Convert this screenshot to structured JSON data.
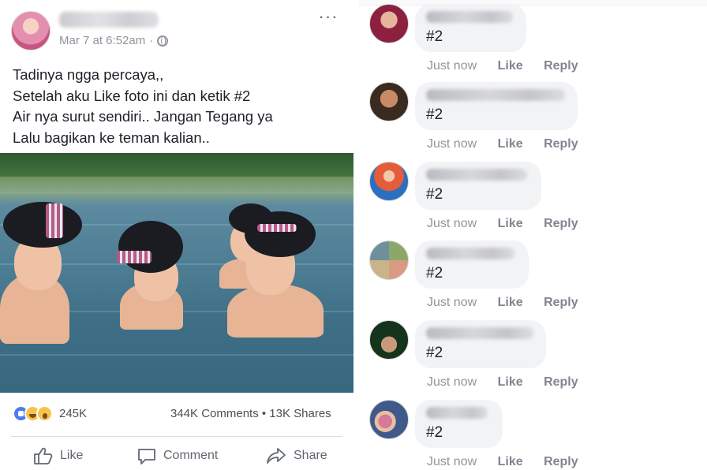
{
  "post": {
    "author_name": "",
    "timestamp": "Mar 7 at 6:52am",
    "separator": "·",
    "privacy_icon": "globe-icon",
    "more_icon": "more-horizontal-icon",
    "more_label": "···",
    "text_lines": [
      "Tadinya ngga percaya,,",
      "Setelah aku Like foto ini dan ketik #2",
      "Air nya surut sendiri.. Jangan Tegang ya",
      "Lalu bagikan ke teman kalian.."
    ],
    "reactions": {
      "icons": [
        "like-reaction-icon",
        "haha-reaction-icon",
        "wow-reaction-icon"
      ],
      "count": "245K"
    },
    "engagement": "344K Comments • 13K Shares",
    "actions": {
      "like": "Like",
      "comment": "Comment",
      "share": "Share"
    }
  },
  "comments": [
    {
      "author_name": "",
      "text": "#2",
      "time": "Just now",
      "like": "Like",
      "reply": "Reply",
      "avatar_colors": [
        "#8b2040",
        "#e7b49c"
      ]
    },
    {
      "author_name": "",
      "text": "#2",
      "time": "Just now",
      "like": "Like",
      "reply": "Reply",
      "avatar_colors": [
        "#3a2a20",
        "#c98b63"
      ]
    },
    {
      "author_name": "",
      "text": "#2",
      "time": "Just now",
      "like": "Like",
      "reply": "Reply",
      "avatar_colors": [
        "#2a6fc2",
        "#e45c3a"
      ]
    },
    {
      "author_name": "",
      "text": "#2",
      "time": "Just now",
      "like": "Like",
      "reply": "Reply",
      "avatar_colors": [
        "#8aa86a",
        "#d99a84"
      ]
    },
    {
      "author_name": "",
      "text": "#2",
      "time": "Just now",
      "like": "Like",
      "reply": "Reply",
      "avatar_colors": [
        "#14341c",
        "#c99a7a"
      ]
    },
    {
      "author_name": "",
      "text": "#2",
      "time": "Just now",
      "like": "Like",
      "reply": "Reply",
      "avatar_colors": [
        "#3f5a8a",
        "#d47a9a"
      ]
    }
  ],
  "colors": {
    "link_gray": "#90949c",
    "action_gray": "#606770",
    "bubble": "#f2f3f5",
    "like_blue": "#4b7bf4",
    "reaction_yellow": "#f7c34b"
  }
}
